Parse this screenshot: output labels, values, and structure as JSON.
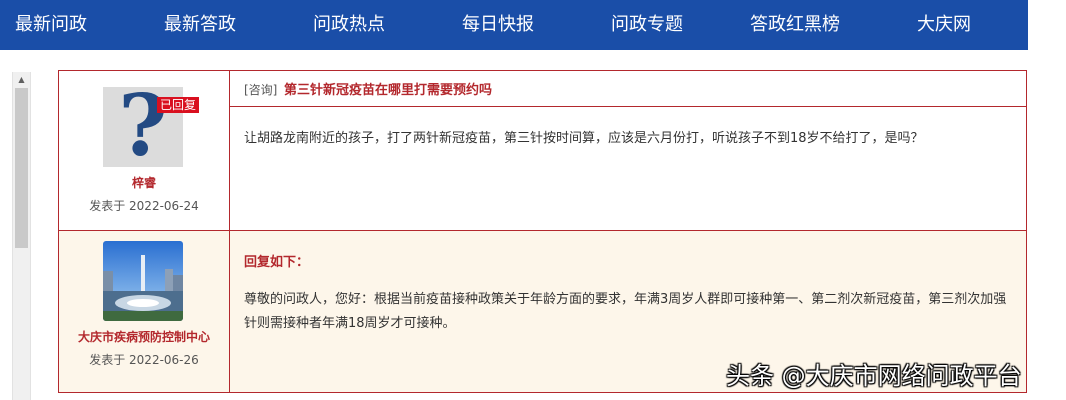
{
  "nav": {
    "items": [
      "最新问政",
      "最新答政",
      "问政热点",
      "每日快报",
      "问政专题",
      "答政红黑榜",
      "大庆网"
    ]
  },
  "question": {
    "badge": "已回复",
    "author": "梓睿",
    "date": "发表于 2022-06-24",
    "category": "[咨询]",
    "title": "第三针新冠疫苗在哪里打需要预约吗",
    "body": "让胡路龙南附近的孩子，打了两针新冠疫苗，第三针按时间算，应该是六月份打，听说孩子不到18岁不给打了，是吗？"
  },
  "reply": {
    "author": "大庆市疾病预防控制中心",
    "date": "发表于 2022-06-26",
    "heading": "回复如下：",
    "body": "尊敬的问政人，您好：根据当前疫苗接种政策关于年龄方面的要求，年满3周岁人群即可接种第一、第二剂次新冠疫苗，第三剂次加强针则需接种者年满18周岁才可接种。"
  },
  "watermark": "头条 @大庆市网络问政平台",
  "colors": {
    "nav_bg": "#1a4ea8",
    "accent_red": "#b3282d",
    "badge_red": "#d9101f",
    "reply_bg": "#fdf6ea"
  }
}
